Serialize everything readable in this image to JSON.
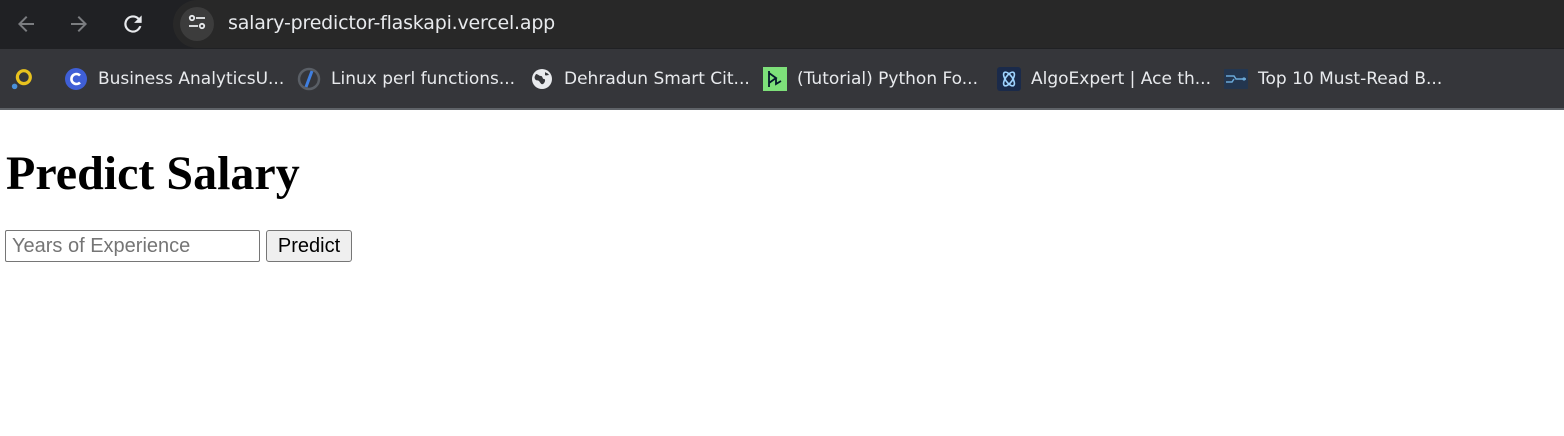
{
  "browser": {
    "url": "salary-predictor-flaskapi.vercel.app",
    "icons": {
      "back": "arrow-left-icon",
      "forward": "arrow-right-icon",
      "reload": "reload-icon",
      "site_info": "tune-icon"
    }
  },
  "bookmarks": {
    "items": [
      {
        "label": "",
        "icon": "extension-icon"
      },
      {
        "label": "Business AnalyticsU...",
        "icon": "c-logo-icon"
      },
      {
        "label": "Linux perl functions...",
        "icon": "slash-logo-icon"
      },
      {
        "label": "Dehradun Smart Cit...",
        "icon": "globe-icon"
      },
      {
        "label": "(Tutorial) Python Fo...",
        "icon": "datacamp-icon"
      },
      {
        "label": "AlgoExpert | Ace th...",
        "icon": "algoexpert-icon"
      },
      {
        "label": "Top 10 Must-Read B...",
        "icon": "circuit-icon"
      }
    ]
  },
  "page": {
    "heading": "Predict Salary",
    "experience_input": {
      "value": "",
      "placeholder": "Years of Experience"
    },
    "predict_button": "Predict"
  },
  "colors": {
    "titlebar_bg": "#202124",
    "omnibox_bg": "#282828",
    "bookmarks_bg": "#35363a",
    "text_light": "#e8eaed"
  }
}
